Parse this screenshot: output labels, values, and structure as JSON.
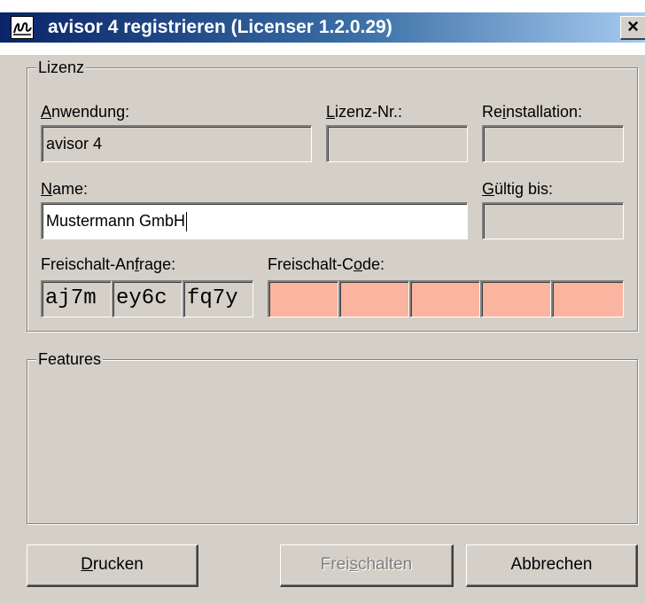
{
  "window": {
    "title": "avisor 4 registrieren (Licenser 1.2.0.29)",
    "close_label": "×",
    "icon": "licenser-app-icon"
  },
  "license_group": {
    "legend": "Lizenz",
    "anwendung": {
      "label_key": "A",
      "label_rest": "nwendung:",
      "value": "avisor 4"
    },
    "lizenz_nr": {
      "label_key": "L",
      "label_rest": "izenz-Nr.:",
      "value": ""
    },
    "reinstallation": {
      "label_pre": "Re",
      "label_key": "i",
      "label_rest": "nstallation:",
      "value": ""
    },
    "name": {
      "label_key": "N",
      "label_rest": "ame:",
      "value": "Mustermann GmbH"
    },
    "gueltig_bis": {
      "label_key": "G",
      "label_rest": "ültig bis:",
      "value": ""
    },
    "freischalt_anfrage": {
      "label_pre": "Freischalt-An",
      "label_key": "f",
      "label_rest": "rage:",
      "values": [
        "aj7m",
        "ey6c",
        "fq7y"
      ]
    },
    "freischalt_code": {
      "label_pre": "Freischalt-C",
      "label_key": "o",
      "label_rest": "de:",
      "values": [
        "",
        "",
        "",
        "",
        ""
      ]
    }
  },
  "features_group": {
    "legend": "Features"
  },
  "buttons": {
    "drucken": {
      "key": "D",
      "rest": "rucken"
    },
    "freischalten": {
      "pre": "Frei",
      "key": "s",
      "rest": "chalten"
    },
    "abbrechen": "Abbrechen"
  },
  "colors": {
    "code_field": "#fab4a0",
    "caption_start": "#0a246a",
    "caption_end": "#a6caf0"
  }
}
